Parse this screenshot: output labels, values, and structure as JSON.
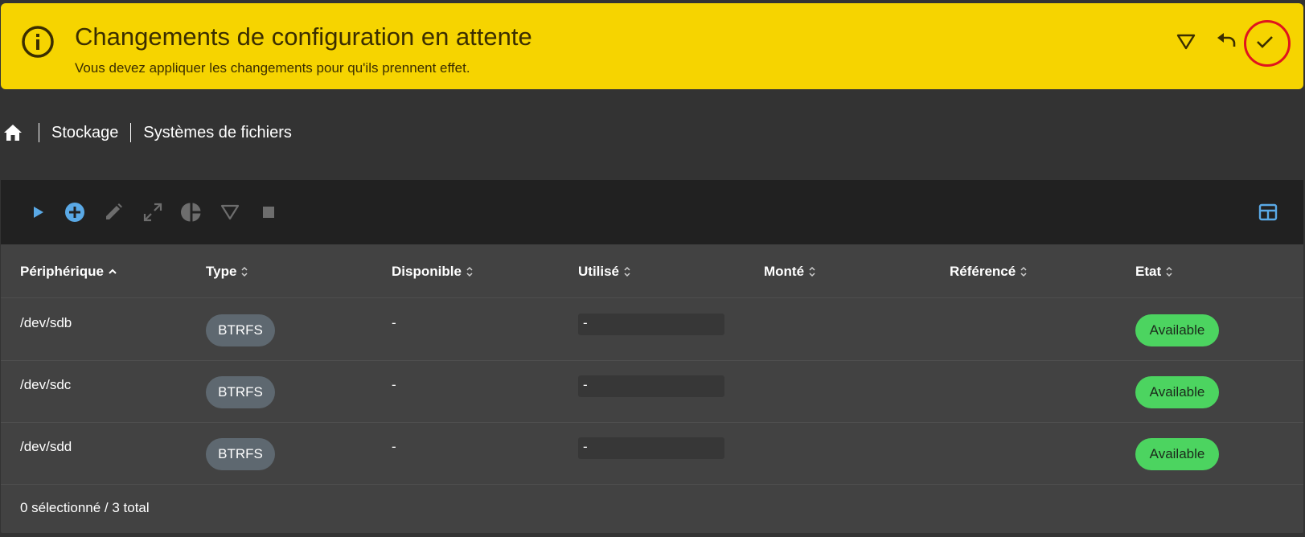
{
  "banner": {
    "title": "Changements de configuration en attente",
    "subtitle": "Vous devez appliquer les changements pour qu'ils prennent effet.",
    "icons": [
      "info-icon",
      "filter-icon",
      "undo-icon",
      "check-icon"
    ],
    "color": "#f6d400",
    "highlight_color": "#e0141e"
  },
  "breadcrumb": {
    "home_icon": "home-icon",
    "items": [
      "Stockage",
      "Systèmes de fichiers"
    ]
  },
  "toolbar": {
    "icons": [
      "play-icon",
      "add-circle-icon",
      "edit-icon",
      "expand-icon",
      "pie-chart-icon",
      "filter-icon",
      "stop-icon",
      "table-view-icon"
    ],
    "accent": "#5aa9e6"
  },
  "table": {
    "columns": [
      "Périphérique",
      "Type",
      "Disponible",
      "Utilisé",
      "Monté",
      "Référencé",
      "Etat"
    ],
    "sorted_column": "Périphérique",
    "rows": [
      {
        "device": "/dev/sdb",
        "type": "BTRFS",
        "available": "-",
        "used": "-",
        "mounted": "",
        "referenced": "",
        "status": "Available"
      },
      {
        "device": "/dev/sdc",
        "type": "BTRFS",
        "available": "-",
        "used": "-",
        "mounted": "",
        "referenced": "",
        "status": "Available"
      },
      {
        "device": "/dev/sdd",
        "type": "BTRFS",
        "available": "-",
        "used": "-",
        "mounted": "",
        "referenced": "",
        "status": "Available"
      }
    ],
    "status_color": "#4cd460",
    "chip_color": "#5e6870"
  },
  "footer": {
    "selection": "0 sélectionné / 3 total"
  }
}
